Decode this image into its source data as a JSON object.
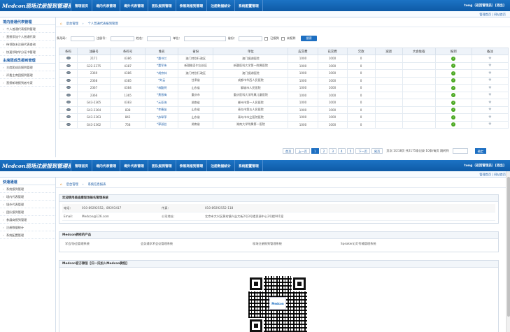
{
  "top": {
    "logo": "Medcon现场注册报到管理系统",
    "nav": [
      "管理首页",
      "境内代表管理",
      "境外代表管理",
      "团队报到管理",
      "参展商报到管理",
      "注册数据统计",
      "系统配置管理"
    ],
    "user": "tong（返回管理员）[退出]",
    "sub_links": "管理首页 | 网站首页"
  },
  "s1": {
    "sidebar": {
      "group1": "境内普通代表管理",
      "items1": [
        "个人普通代表报到管理",
        "直接添加个人普通代表",
        "待领取未注册代表查询",
        "快速领取学分证书管理"
      ],
      "group2": "主席团成员报到管理",
      "items2": [
        "主席团成员报到管理",
        "评委主席团报到管理",
        "直接新增报到者专家"
      ]
    },
    "crumbs": [
      "后台管理",
      "个人普通代表报到管理"
    ],
    "filter": {
      "l1": "条形码：",
      "l2": "注册号：",
      "l3": "姓名：",
      "l4": "单位：",
      "l5": "省份：",
      "c1": "已报到",
      "c2": "未报到",
      "btn": "搜索"
    },
    "columns": [
      "条码",
      "注册号",
      "条码号",
      "姓名",
      "省份",
      "单位",
      "应交费",
      "已交费",
      "欠款",
      "减退",
      "大会住宿",
      "报到",
      "备注"
    ],
    "rows": [
      [
        "2171",
        "4386",
        "*惠书兰",
        "澳门特别行政区",
        "澳门镜湖医院",
        "1000",
        "1000",
        "0"
      ],
      [
        "G22-2375",
        "4387",
        "*董军伟",
        "新疆维吾尔自治区",
        "新疆医科大学第一附属医院",
        "1000",
        "1000",
        "0"
      ],
      [
        "2369",
        "4386",
        "*胡宗林",
        "澳门特别行政区",
        "澳门镜湖医院",
        "1000",
        "1000",
        "0"
      ],
      [
        "2368",
        "4385",
        "*刘云",
        "甘肃省",
        "成都市华西人民医院",
        "1000",
        "1000",
        "0"
      ],
      [
        "2367",
        "4384",
        "*林勤明",
        "山东省",
        "聊城市人民医院",
        "1000",
        "1000",
        "0"
      ],
      [
        "2366",
        "1365",
        "*黄晋梅",
        "重庆市",
        "重庆医科大学附属儿童医院",
        "1000",
        "1000",
        "0"
      ],
      [
        "G43-2365",
        "4383",
        "*元亚海",
        "湖南省",
        "郴州市第一人民医院",
        "1000",
        "1000",
        "0"
      ],
      [
        "G43-2364",
        "838",
        "*李春苗",
        "山东省",
        "青岛市第五人民医院",
        "1000",
        "1000",
        "0"
      ],
      [
        "G43-2363",
        "842",
        "*苏翠萍",
        "山东省",
        "青岛市市立医院医院",
        "1000",
        "1000",
        "0"
      ],
      [
        "G43-2362",
        "758",
        "*郭淑芸",
        "湖南省",
        "湖南大学附属第一医院",
        "1000",
        "1000",
        "0"
      ]
    ],
    "pager": {
      "first": "首页",
      "prev": "上一页",
      "pages": [
        "1",
        "2",
        "3",
        "4",
        "5"
      ],
      "next": "下一页",
      "last": "尾页",
      "info": "页次:1/218页 共2175条记录 10条/每页 跳转到",
      "go": "确定"
    }
  },
  "s2": {
    "sidebar": {
      "group": "快速通道",
      "items": [
        "系统报到管理",
        "境内代表管理",
        "境外代表管理",
        "团队报到管理",
        "参展商报到管理",
        "注册数据统计",
        "系统配置管理"
      ]
    },
    "crumbs": [
      "后台管理",
      "系统信息报表"
    ],
    "contact": {
      "title": "欢迎使用美迪康现场报名管理系统",
      "phone_label": "电话：",
      "phone": "010-89292552，89293417",
      "fax_label": "传真：",
      "fax": "010-89292552-118",
      "email_label": "Email:",
      "email": "Medcon@126.com",
      "addr_label": "公司地址：",
      "addr": "北京市大兴区黄村镇兴业大街2号3号楼资源中心2号楼901室"
    },
    "products": {
      "title": "Medcon拥有的产品",
      "items": [
        "学会/协会管理系统",
        "会务通学术会议管理系统",
        "现场注册报到管理系统",
        "Speaker幻灯传输管理系统"
      ]
    },
    "weixin": {
      "title": "Medcon官方微信【扫一扫加入Medcon微信】",
      "qr_center": "Medcon"
    }
  }
}
